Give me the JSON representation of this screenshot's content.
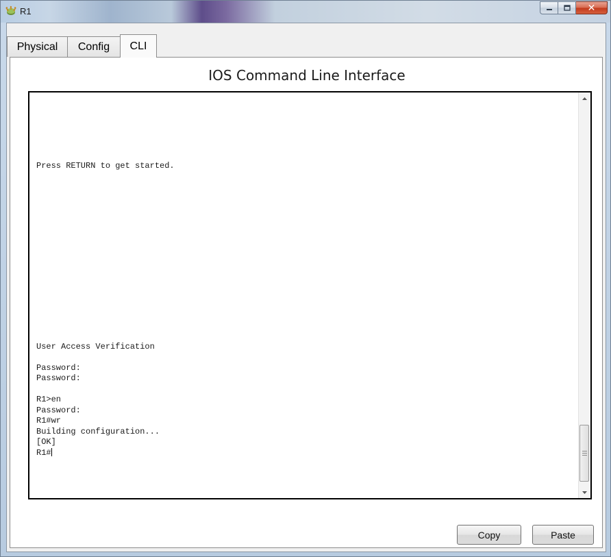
{
  "window": {
    "title": "R1",
    "icon": "router-app-icon",
    "controls": {
      "minimize": "minimize-icon",
      "maximize": "maximize-icon",
      "close": "close-icon"
    }
  },
  "tabs": [
    {
      "label": "Physical",
      "active": false
    },
    {
      "label": "Config",
      "active": false
    },
    {
      "label": "CLI",
      "active": true
    }
  ],
  "cli": {
    "title": "IOS Command Line Interface",
    "output_lines": [
      "",
      "",
      "",
      "",
      "",
      "",
      "Press RETURN to get started.",
      "",
      "",
      "",
      "",
      "",
      "",
      "",
      "",
      "",
      "",
      "",
      "",
      "",
      "",
      "",
      "",
      "User Access Verification",
      "",
      "Password:",
      "Password:",
      "",
      "R1>en",
      "Password:",
      "R1#wr",
      "Building configuration...",
      "[OK]"
    ],
    "prompt": "R1#",
    "scroll_position": 1.0
  },
  "buttons": {
    "copy": "Copy",
    "paste": "Paste"
  },
  "colors": {
    "close_button": "#c2391c",
    "terminal_border": "#000000"
  }
}
